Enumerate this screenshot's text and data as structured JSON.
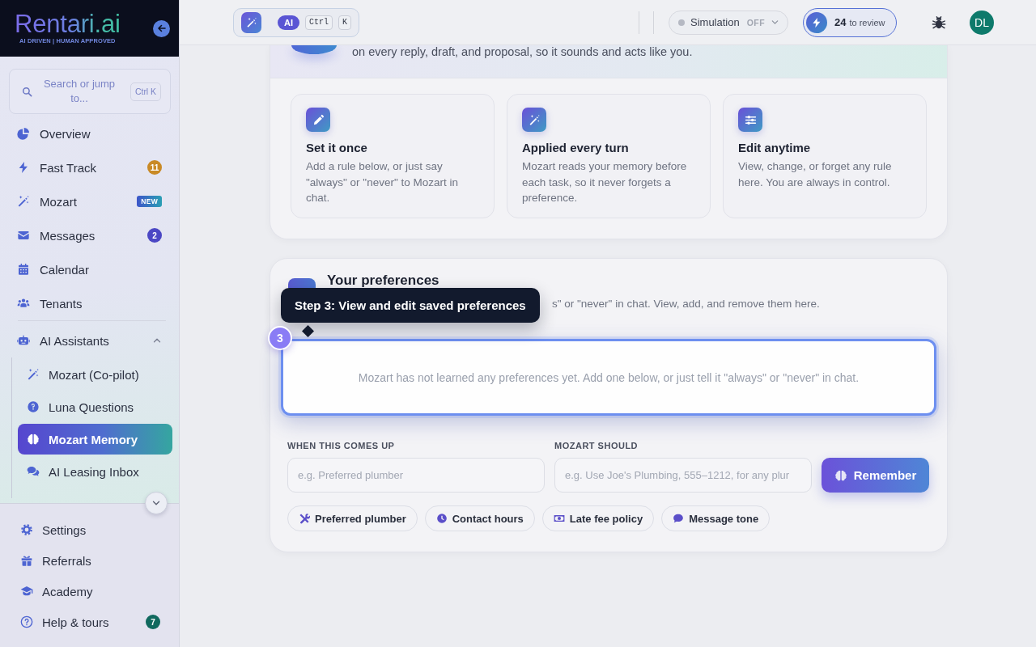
{
  "sidebar": {
    "logo": "Rentari.ai",
    "tagline": "AI DRIVEN | HUMAN APPROVED",
    "search": {
      "label": "Search or jump to...",
      "shortcut": "Ctrl K"
    },
    "items": [
      {
        "label": "Overview",
        "selected": false
      },
      {
        "label": "Fast Track",
        "selected": false,
        "badge": {
          "kind": "count",
          "text": "11",
          "color": "#c98a26"
        }
      },
      {
        "label": "Mozart",
        "selected": false,
        "badge": {
          "kind": "tag",
          "text": "NEW"
        }
      },
      {
        "label": "Messages",
        "selected": false,
        "badge": {
          "kind": "count",
          "text": "2",
          "color": "#4b47c4"
        }
      },
      {
        "label": "Calendar",
        "selected": false
      },
      {
        "label": "Tenants",
        "selected": false
      },
      {
        "label": "AI Assistants",
        "selected": false,
        "expanded": true,
        "children": [
          {
            "label": "Mozart (Co-pilot)",
            "selected": false
          },
          {
            "label": "Luna Questions",
            "selected": false
          },
          {
            "label": "Mozart Memory",
            "selected": true
          },
          {
            "label": "AI Leasing Inbox",
            "selected": false
          }
        ]
      }
    ],
    "footer_items": [
      {
        "label": "Settings",
        "selected": false
      },
      {
        "label": "Referrals",
        "selected": false
      },
      {
        "label": "Academy",
        "selected": false
      },
      {
        "label": "Help & tours",
        "selected": false,
        "badge": {
          "kind": "count",
          "text": "7",
          "color": "#10695e"
        }
      }
    ]
  },
  "topbar": {
    "assistant": {
      "badge": "AI",
      "keys": [
        "Ctrl",
        "K"
      ]
    },
    "simulation": {
      "label": "Simulation",
      "status": "OFF",
      "on": false
    },
    "review": {
      "count": "24",
      "label": "to review"
    },
    "avatar": "DL"
  },
  "intro": {
    "text": "on every reply, draft, and proposal, so it sounds and acts like you.",
    "features": [
      {
        "title": "Set it once",
        "text": "Add a rule below, or just say \"always\" or \"never\" to Mozart in chat."
      },
      {
        "title": "Applied every turn",
        "text": "Mozart reads your memory before each task, so it never forgets a preference."
      },
      {
        "title": "Edit anytime",
        "text": "View, change, or forget any rule here. You are always in control."
      }
    ]
  },
  "preferences": {
    "title": "Your preferences",
    "description": "s\" or \"never\" in chat. View, add, and remove them here.",
    "empty_message": "Mozart has not learned any preferences yet. Add one below, or just tell it \"always\" or \"never\" in chat.",
    "fields": [
      {
        "label": "WHEN THIS COMES UP",
        "placeholder": "e.g. Preferred plumber"
      },
      {
        "label": "MOZART SHOULD",
        "placeholder": "e.g. Use Joe's Plumbing, 555–1212, for any plur"
      }
    ],
    "submit": "Remember",
    "suggestions": [
      "Preferred plumber",
      "Contact hours",
      "Late fee policy",
      "Message tone"
    ]
  },
  "tour": {
    "step": "3",
    "title": "Step 3: View and edit saved preferences"
  }
}
